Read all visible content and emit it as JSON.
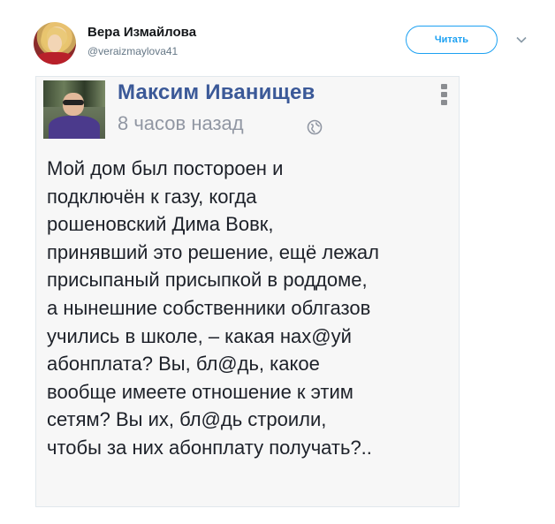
{
  "tweet": {
    "author_name": "Вера Измайлова",
    "author_handle": "@veraizmaylova41",
    "follow_label": "Читать"
  },
  "embedded_post": {
    "author": "Максим Иванищев",
    "time": "8 часов назад",
    "lines": [
      "Мой дом был постороен и",
      "подключён к газу, когда",
      "рошеновский Дима Вовк,",
      "принявший это решение, ещё лежал",
      "присыпаный присыпкой в роддоме,",
      "а нынешние собственники облгазов",
      "учились в школе, – какая нах@уй",
      "абонплата? Вы, бл@дь, какое",
      "вообще имеете отношение к этим",
      "сетям? Вы их, бл@дь строили,",
      "чтобы за них абонплату получать?.."
    ]
  },
  "icons": {
    "globe": "globe-icon",
    "more": "more-vertical-icon",
    "chevron": "chevron-down-icon"
  },
  "colors": {
    "twitter_blue": "#1da1f2",
    "facebook_blue": "#3b5998",
    "meta_gray": "#9197a3"
  }
}
